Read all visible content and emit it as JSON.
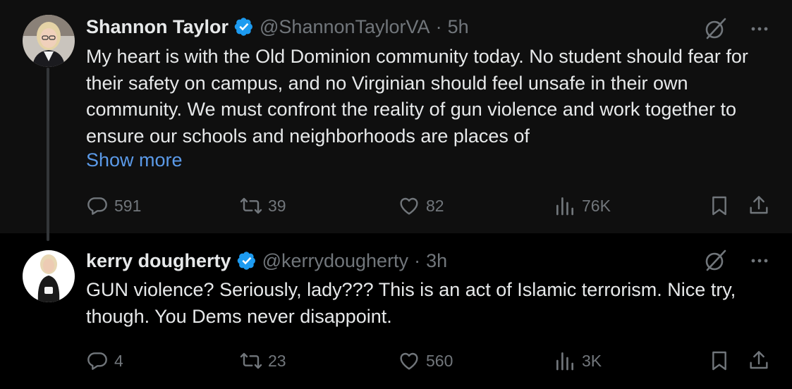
{
  "posts": [
    {
      "display_name": "Shannon Taylor",
      "handle": "@ShannonTaylorVA",
      "separator": "·",
      "time": "5h",
      "text": "My heart is with the Old Dominion community today. No student should fear for their safety on campus, and no Virginian should feel unsafe in their own community. We must confront the reality of gun violence and work together to ensure our schools and neighborhoods are places of",
      "show_more": "Show more",
      "stats": {
        "replies": "591",
        "reposts": "39",
        "likes": "82",
        "views": "76K"
      }
    },
    {
      "display_name": "kerry dougherty",
      "handle": "@kerrydougherty",
      "separator": "·",
      "time": "3h",
      "text": "GUN violence? Seriously, lady??? This is an act of Islamic terrorism. Nice try, though. You Dems never disappoint.",
      "stats": {
        "replies": "4",
        "reposts": "23",
        "likes": "560",
        "views": "3K"
      }
    }
  ],
  "colors": {
    "background": "#000000",
    "parent_post_background": "#0f0f0f",
    "text": "#e7e9ea",
    "muted": "#71767b",
    "link": "#5b9ae8",
    "verified": "#1d9bf0"
  },
  "icons": [
    "verified-badge-icon",
    "grok-icon",
    "more-icon",
    "reply-icon",
    "repost-icon",
    "like-icon",
    "views-icon",
    "bookmark-icon",
    "share-icon"
  ]
}
